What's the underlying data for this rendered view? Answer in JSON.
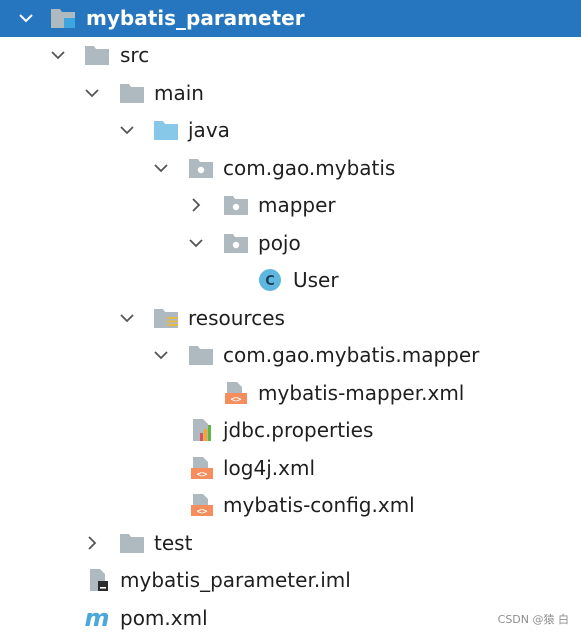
{
  "tree": {
    "root": "mybatis_parameter",
    "src": "src",
    "main": "main",
    "java": "java",
    "pkg": "com.gao.mybatis",
    "mapper": "mapper",
    "pojo": "pojo",
    "user": "User",
    "resources": "resources",
    "res_pkg": "com.gao.mybatis.mapper",
    "mapper_xml": "mybatis-mapper.xml",
    "jdbc": "jdbc.properties",
    "log4j": "log4j.xml",
    "config": "mybatis-config.xml",
    "test": "test",
    "iml": "mybatis_parameter.iml",
    "pom": "pom.xml"
  },
  "icons": {
    "class_letter": "C",
    "pom_letter": "m",
    "xml_glyph": "<>"
  },
  "watermark": "CSDN @猿 白",
  "colors": {
    "selection": "#2675BF",
    "folder": "#AEB9C0",
    "source_folder": "#87C7E8",
    "xml_badge": "#F58D5D",
    "class_badge": "#5FB7E0",
    "maven_m": "#4BA8D9"
  }
}
